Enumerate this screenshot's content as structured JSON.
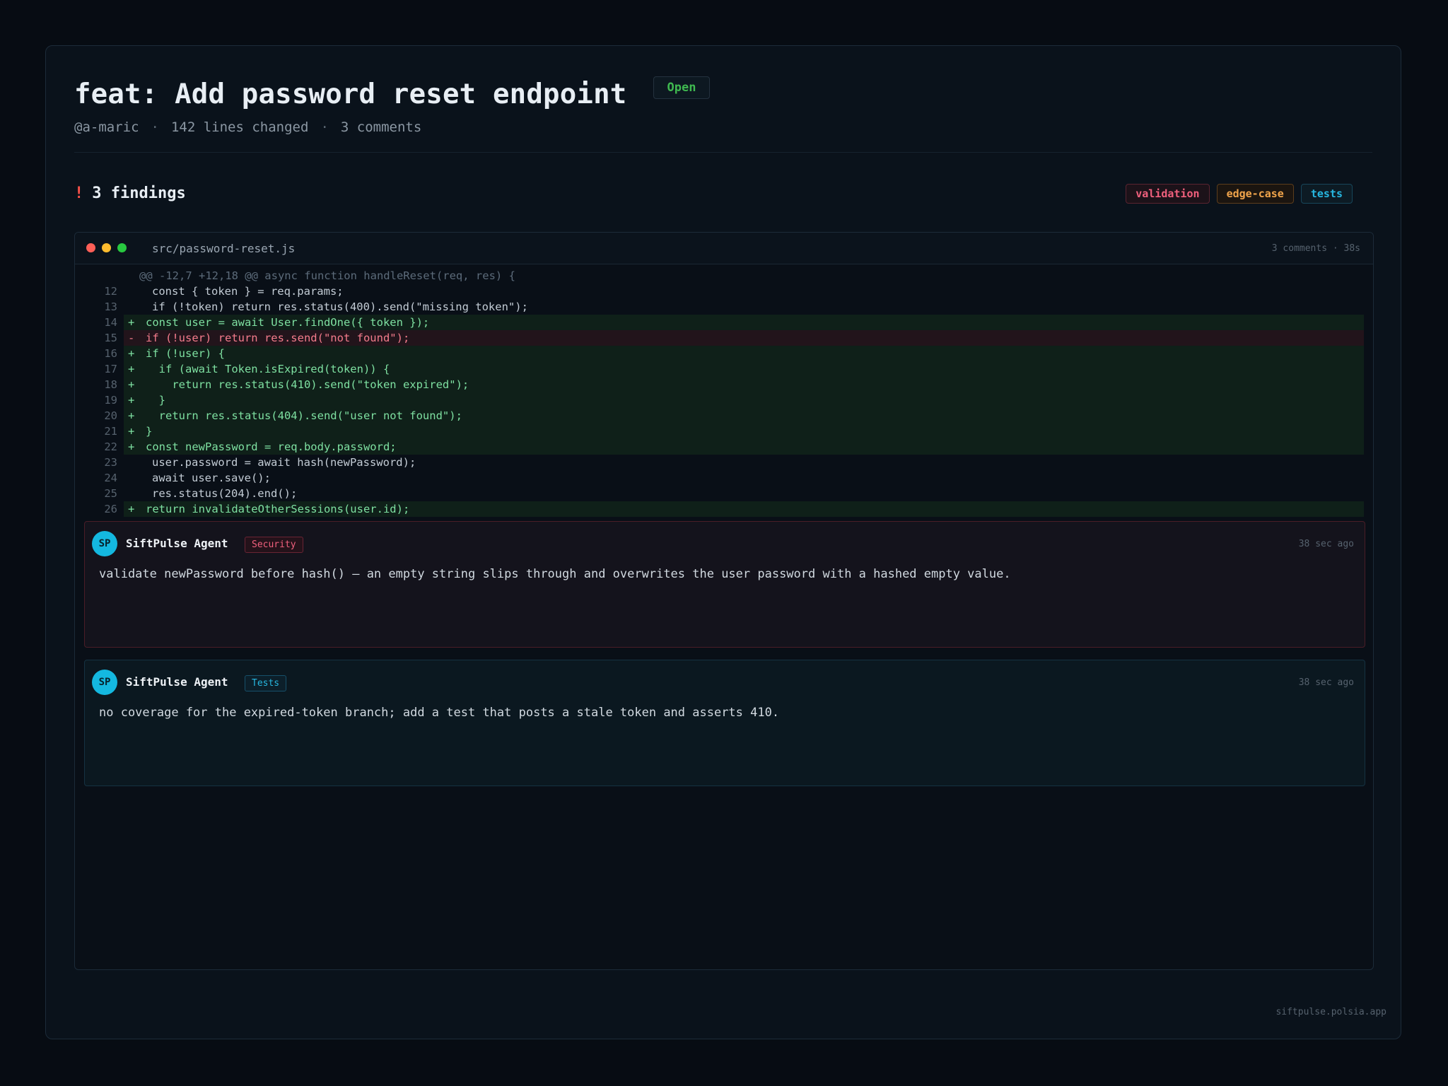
{
  "pr": {
    "title": "feat: Add password reset endpoint",
    "status": "Open",
    "author": "@a-maric",
    "lines_changed": "142 lines changed",
    "comments": "3 comments",
    "separator": "·"
  },
  "findings": {
    "icon": "!",
    "label": "3 findings",
    "tags": [
      "validation",
      "edge-case",
      "tests"
    ]
  },
  "file": {
    "name": "src/password-reset.js",
    "meta": "3 comments · 38s",
    "hunk": "@@ -12,7 +12,18 @@ async function handleReset(req, res) {",
    "lines": [
      {
        "n": "12",
        "t": "ctx",
        "m": "",
        "c": "const { token } = req.params;"
      },
      {
        "n": "13",
        "t": "ctx",
        "m": "",
        "c": "if (!token) return res.status(400).send(\"missing token\");"
      },
      {
        "n": "14",
        "t": "add",
        "m": "+",
        "c": "const user = await User.findOne({ token });"
      },
      {
        "n": "15",
        "t": "del",
        "m": "-",
        "c": "if (!user) return res.send(\"not found\");"
      },
      {
        "n": "16",
        "t": "add",
        "m": "+",
        "c": "if (!user) {"
      },
      {
        "n": "17",
        "t": "add",
        "m": "+",
        "c": "  if (await Token.isExpired(token)) {"
      },
      {
        "n": "18",
        "t": "add",
        "m": "+",
        "c": "    return res.status(410).send(\"token expired\");"
      },
      {
        "n": "19",
        "t": "add",
        "m": "+",
        "c": "  }"
      },
      {
        "n": "20",
        "t": "add",
        "m": "+",
        "c": "  return res.status(404).send(\"user not found\");"
      },
      {
        "n": "21",
        "t": "add",
        "m": "+",
        "c": "}"
      },
      {
        "n": "22",
        "t": "add",
        "m": "+",
        "c": "const newPassword = req.body.password;"
      },
      {
        "n": "23",
        "t": "ctx",
        "m": "",
        "c": "user.password = await hash(newPassword);"
      },
      {
        "n": "24",
        "t": "ctx",
        "m": "",
        "c": "await user.save();"
      },
      {
        "n": "25",
        "t": "ctx",
        "m": "",
        "c": "res.status(204).end();"
      },
      {
        "n": "26",
        "t": "add",
        "m": "+",
        "c": "return invalidateOtherSessions(user.id);"
      }
    ]
  },
  "comments": [
    {
      "initials": "SP",
      "author": "SiftPulse Agent",
      "tag": "Security",
      "time": "38 sec ago",
      "text": "validate newPassword before hash() — an empty string slips through and overwrites the user password with a hashed empty value."
    },
    {
      "initials": "SP",
      "author": "SiftPulse Agent",
      "tag": "Tests",
      "time": "38 sec ago",
      "text": "no coverage for the expired-token branch; add a test that posts a stale token and asserts 410."
    }
  ],
  "footer": "siftpulse.polsia.app",
  "colors": {
    "background": "#070c13",
    "status_open": "#3fb950",
    "finding_alert": "#f85149",
    "added_line": "#7ee0a1",
    "removed_line": "#f47c8c",
    "avatar": "#14b8e0"
  }
}
